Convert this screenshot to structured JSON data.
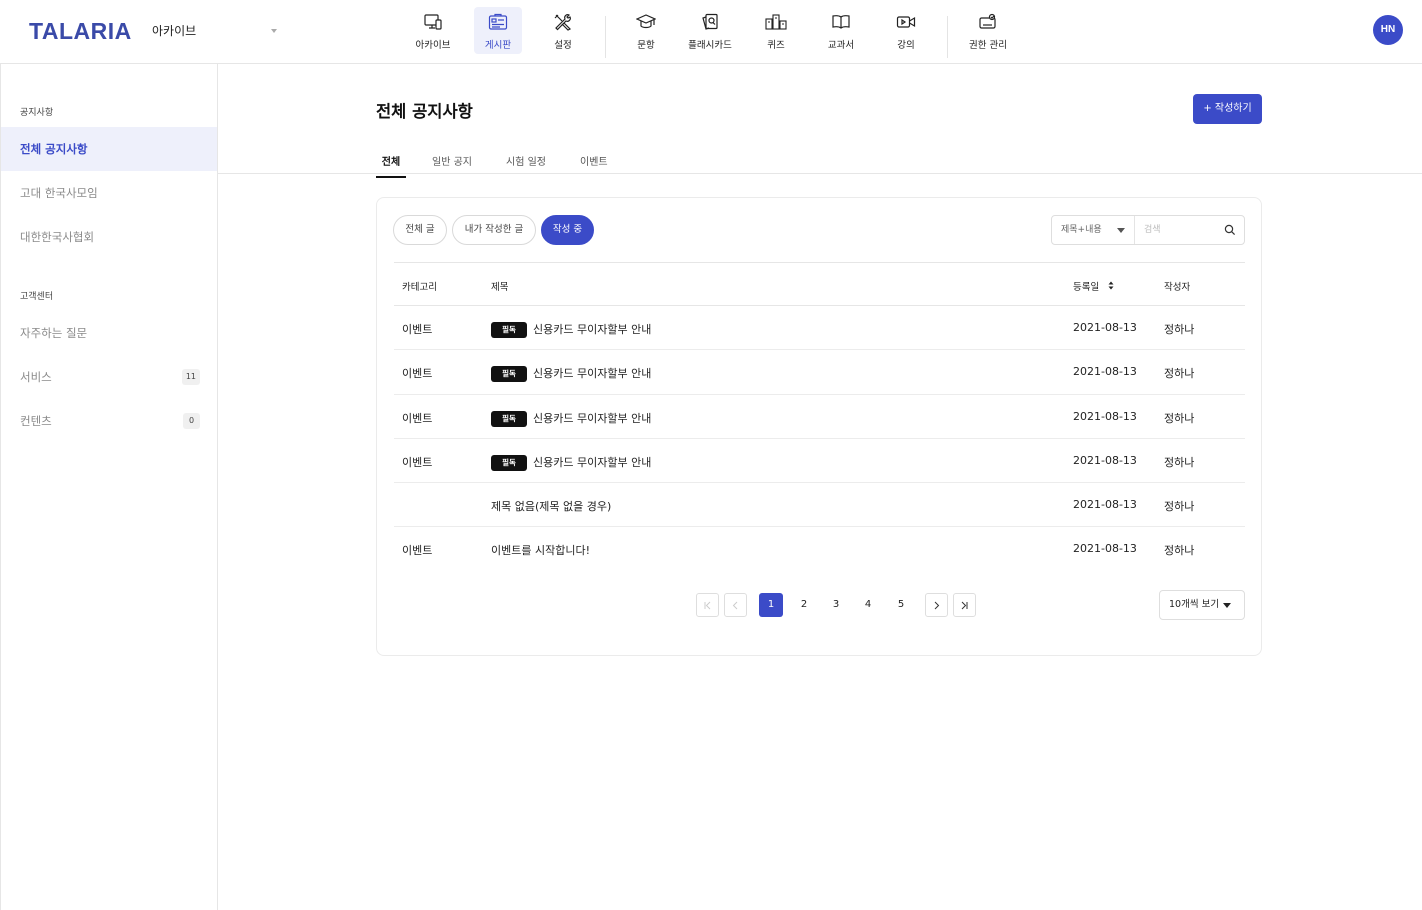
{
  "header": {
    "logo": "TALARIA",
    "archive_select": "아카이브",
    "nav": [
      {
        "label": "아카이브",
        "icon": "monitor-devices-icon",
        "active": false
      },
      {
        "label": "게시판",
        "icon": "board-icon",
        "active": true
      },
      {
        "label": "설정",
        "icon": "tools-icon",
        "active": false
      },
      {
        "label": "문항",
        "icon": "graduation-cap-icon",
        "active": false
      },
      {
        "label": "플래시카드",
        "icon": "flashcard-icon",
        "active": false
      },
      {
        "label": "퀴즈",
        "icon": "quiz-icon",
        "active": false
      },
      {
        "label": "교과서",
        "icon": "book-icon",
        "active": false
      },
      {
        "label": "강의",
        "icon": "video-icon",
        "active": false
      },
      {
        "label": "권한 관리",
        "icon": "permission-icon",
        "active": false
      }
    ],
    "avatar": "HN"
  },
  "sidebar": {
    "section1": "공지사항",
    "items1": [
      {
        "label": "전체 공지사항",
        "active": true
      },
      {
        "label": "고대 한국사모임",
        "active": false
      },
      {
        "label": "대한한국사협회",
        "active": false
      }
    ],
    "section2": "고객센터",
    "items2": [
      {
        "label": "자주하는 질문",
        "badge": ""
      },
      {
        "label": "서비스",
        "badge": "11"
      },
      {
        "label": "컨텐츠",
        "badge": "0"
      }
    ]
  },
  "main": {
    "title": "전체 공지사항",
    "write_button": "+ 작성하기",
    "tabs": [
      "전체",
      "일반 공지",
      "시험 일정",
      "이벤트"
    ],
    "filters": [
      "전체 글",
      "내가 작성한 글",
      "작성 중"
    ],
    "search_type": "제목+내용",
    "search_placeholder": "검색",
    "columns": [
      "카테고리",
      "제목",
      "등록일",
      "작성자"
    ],
    "rows": [
      {
        "category": "이벤트",
        "tag": "필독",
        "title": "신용카드 무이자할부 안내",
        "date": "2021-08-13",
        "author": "정하나"
      },
      {
        "category": "이벤트",
        "tag": "필독",
        "title": "신용카드 무이자할부 안내",
        "date": "2021-08-13",
        "author": "정하나"
      },
      {
        "category": "이벤트",
        "tag": "필독",
        "title": "신용카드 무이자할부 안내",
        "date": "2021-08-13",
        "author": "정하나"
      },
      {
        "category": "이벤트",
        "tag": "필독",
        "title": "신용카드 무이자할부 안내",
        "date": "2021-08-13",
        "author": "정하나"
      },
      {
        "category": "",
        "tag": "",
        "title": "제목 없음(제목 없을 경우)",
        "date": "2021-08-13",
        "author": "정하나"
      },
      {
        "category": "이벤트",
        "tag": "",
        "title": "이벤트를 시작합니다!",
        "date": "2021-08-13",
        "author": "정하나"
      }
    ],
    "pages": [
      "1",
      "2",
      "3",
      "4",
      "5"
    ],
    "current_page": "1",
    "per_page": "10개씩 보기"
  },
  "colors": {
    "accent": "#3b4bc8",
    "brand": "#3a4aa8",
    "active_bg": "#eef0fb"
  }
}
